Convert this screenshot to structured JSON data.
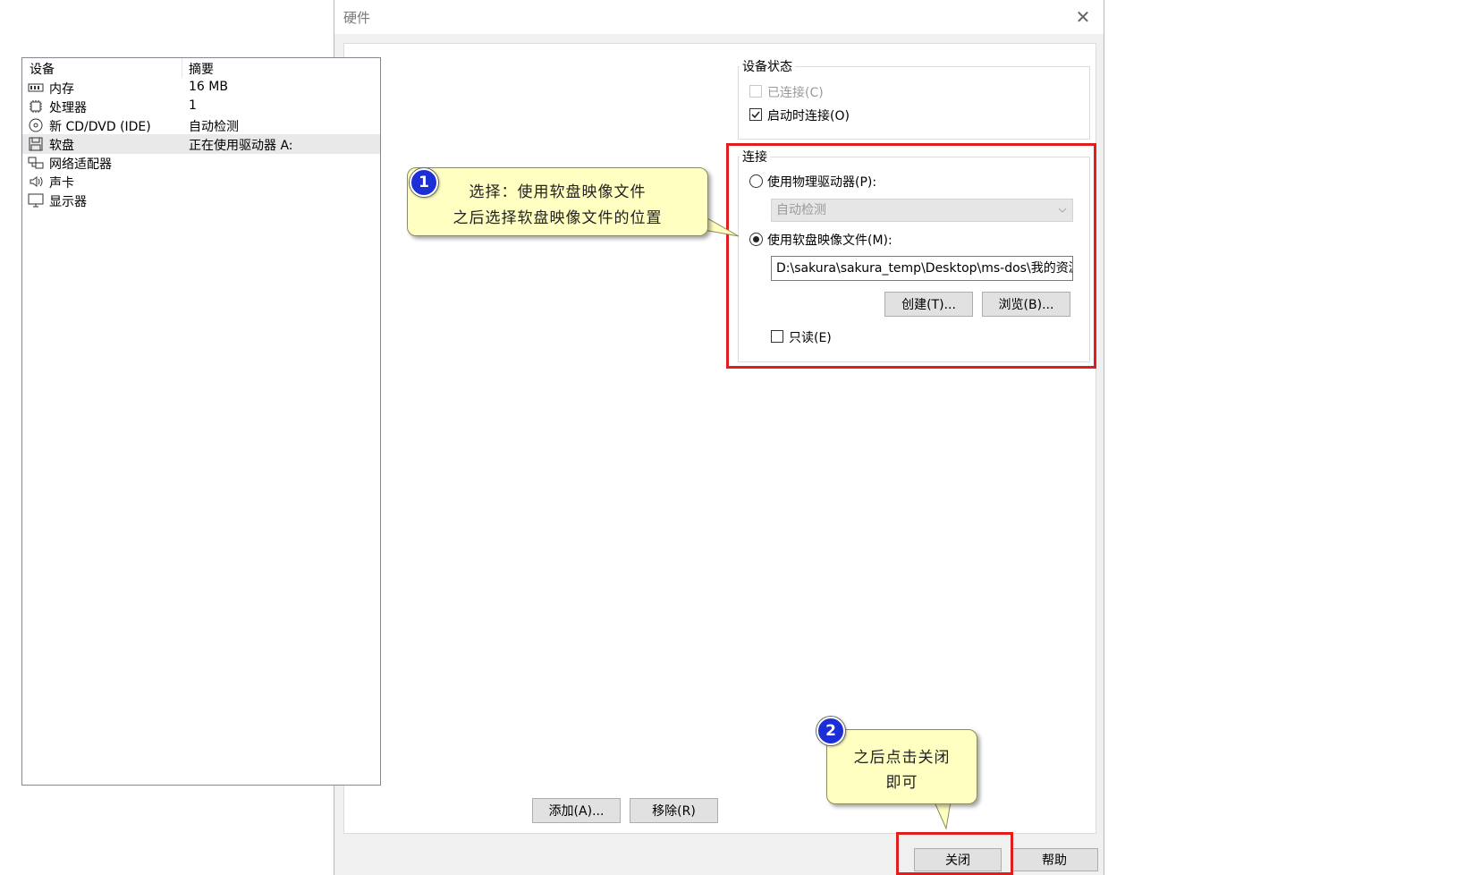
{
  "window": {
    "title": "硬件",
    "close_glyph": "✕"
  },
  "device_list": {
    "columns": [
      "设备",
      "摘要"
    ],
    "rows": [
      {
        "device": "内存",
        "summary": "16 MB",
        "icon": "memory-icon"
      },
      {
        "device": "处理器",
        "summary": "1",
        "icon": "processor-icon"
      },
      {
        "device": "新 CD/DVD (IDE)",
        "summary": "自动检测",
        "icon": "cd-icon"
      },
      {
        "device": "软盘",
        "summary": "正在使用驱动器 A:",
        "icon": "floppy-icon",
        "selected": true
      },
      {
        "device": "网络适配器",
        "summary": "",
        "icon": "network-icon"
      },
      {
        "device": "声卡",
        "summary": "",
        "icon": "sound-icon"
      },
      {
        "device": "显示器",
        "summary": "",
        "icon": "display-icon"
      }
    ]
  },
  "buttons": {
    "add": "添加(A)...",
    "remove": "移除(R)",
    "create": "创建(T)...",
    "browse": "浏览(B)...",
    "close": "关闭",
    "help": "帮助"
  },
  "device_status": {
    "label": "设备状态",
    "connected": {
      "label": "已连接(C)",
      "checked": false,
      "enabled": false
    },
    "connect_on_start": {
      "label": "启动时连接(O)",
      "checked": true,
      "enabled": true
    }
  },
  "connection": {
    "label": "连接",
    "physical": {
      "label": "使用物理驱动器(P):",
      "selected": false
    },
    "physical_combo": {
      "value": "自动检测",
      "enabled": false
    },
    "image": {
      "label": "使用软盘映像文件(M):",
      "selected": true
    },
    "image_path": "D:\\sakura\\sakura_temp\\Desktop\\ms-dos\\我的资源",
    "readonly": {
      "label": "只读(E)",
      "checked": false
    }
  },
  "annotations": {
    "note1": {
      "number": "1",
      "line1": "选择：使用软盘映像文件",
      "line2": "之后选择软盘映像文件的位置"
    },
    "note2": {
      "number": "2",
      "line1": "之后点击关闭",
      "line2": "即可"
    }
  },
  "colors": {
    "highlight_red": "#e01e1e",
    "callout_fill": "#ffffc2",
    "badge_blue": "#1c2fd6"
  }
}
